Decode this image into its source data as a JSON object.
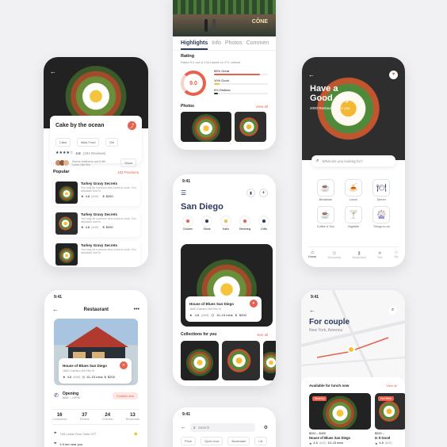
{
  "phone_top": {
    "sign": "CÔNE",
    "tabs": [
      "Highlights",
      "Info",
      "Photos",
      "Commen"
    ],
    "rating_title": "Rating",
    "rating_sub": "Rated 9.0 out of 134 based on 271 visitors",
    "score": "9.0",
    "bars": [
      {
        "label": "85% Great",
        "value": 0.85,
        "color": "#e8614d"
      },
      {
        "label": "10% Good",
        "value": 0.1,
        "color": "#f0c43a"
      },
      {
        "label": "5% Dislikes",
        "value": 0.05,
        "color": "#333333"
      }
    ],
    "photos_label": "Photos",
    "view_all": "View all"
  },
  "phone_cake": {
    "title": "Cake by the ocean",
    "tags": [
      "Cake",
      "Italia Food",
      "Girl"
    ],
    "rating": "4.8",
    "reviews": "(194 Reviews)",
    "reviewers": "Marine Matthews and Edith Laura Like this",
    "show": "Show",
    "popular": "Popular",
    "positions": "183 Positions",
    "items": [
      {
        "name": "Turkey Gravy Secrets",
        "desc": "You may be a person who loves to cook. You absolutel love to",
        "rating": "4.8",
        "count": "(849)",
        "price": "$200"
      },
      {
        "name": "Turkey Gravy Secrets",
        "desc": "You may be a person who loves to cook. You absolutel love to",
        "rating": "4.8",
        "count": "(849)",
        "price": "$200"
      },
      {
        "name": "Turkey Gravy Secrets",
        "desc": "You may be a person who loves to cook. You absolutel love to",
        "rating": "",
        "count": "",
        "price": ""
      }
    ]
  },
  "phone_good_day": {
    "greeting": "Have a Good day",
    "subtitle": "2000 Restaurants for you",
    "search_placeholder": "What are you looking for?",
    "categories": [
      {
        "label": "Breakfast",
        "icon": "breakfast-icon",
        "glyph": "☕"
      },
      {
        "label": "Lunch",
        "icon": "lunch-icon",
        "glyph": "🍝"
      },
      {
        "label": "Dinner",
        "icon": "dinner-icon",
        "glyph": "🍽"
      },
      {
        "label": "Coffee & Tea",
        "icon": "coffee-icon",
        "glyph": "☕"
      },
      {
        "label": "Nightlife",
        "icon": "nightlife-icon",
        "glyph": "🍸"
      },
      {
        "label": "Things to do",
        "icon": "things-icon",
        "glyph": "🎡"
      }
    ],
    "nav": [
      "Home",
      "Discovery",
      "Bookmark",
      "Trel",
      "My"
    ]
  },
  "phone_san_diego": {
    "time": "9:41",
    "city": "San Diego",
    "filters": [
      "Chicken",
      "Steak",
      "Kabs",
      "Steaming",
      "Grills"
    ],
    "featured": {
      "name": "House of Blues San Diego",
      "address": "1840 Camino Del Rio N",
      "rating": "4.8",
      "count": "(849)",
      "time": "10–15 mins",
      "price": "$200"
    },
    "collections": "Collections for you",
    "see_all": "See all"
  },
  "phone_restaurant": {
    "time": "9:41",
    "title": "Restaurant",
    "card": {
      "name": "House of Blues San Diego",
      "address": "1840 Camino Del Rio N",
      "rating": "4.8",
      "count": "(849)",
      "time": "10–15 mins",
      "price": "$200"
    },
    "opening": "Opening",
    "hours": "8AM – 10PM",
    "contact": "Contact now",
    "stats": [
      {
        "value": "16",
        "label": "Comments"
      },
      {
        "value": "37",
        "label": "Photos"
      },
      {
        "value": "24",
        "label": "Checkin"
      },
      {
        "value": "13",
        "label": "Bookmark"
      }
    ],
    "address": "765 Larkin Row Suite 077",
    "distance": "4.9 km near you"
  },
  "phone_couple": {
    "time": "9:41",
    "title": "For couple",
    "location": "New York, America",
    "available": "Available for lunch now",
    "view_all": "View all",
    "cards": [
      {
        "badge": "Most try",
        "price": "$200 – $400",
        "name": "House of Blues San Diego",
        "rating": "4.8",
        "count": "(849)",
        "time": "10–15 mins"
      },
      {
        "badge": "Hot Wea",
        "price": "$200 –",
        "name": "Is It Good",
        "rating": "4.8",
        "count": "(849)",
        "time": ""
      }
    ]
  },
  "phone_search": {
    "time": "9:41",
    "placeholder": "Search",
    "chips": [
      "Price",
      "Open now",
      "Bookmark",
      "Lik"
    ]
  },
  "colors": {
    "accent": "#e8614d",
    "navy": "#2a3a5a",
    "yellow": "#f0c43a"
  }
}
